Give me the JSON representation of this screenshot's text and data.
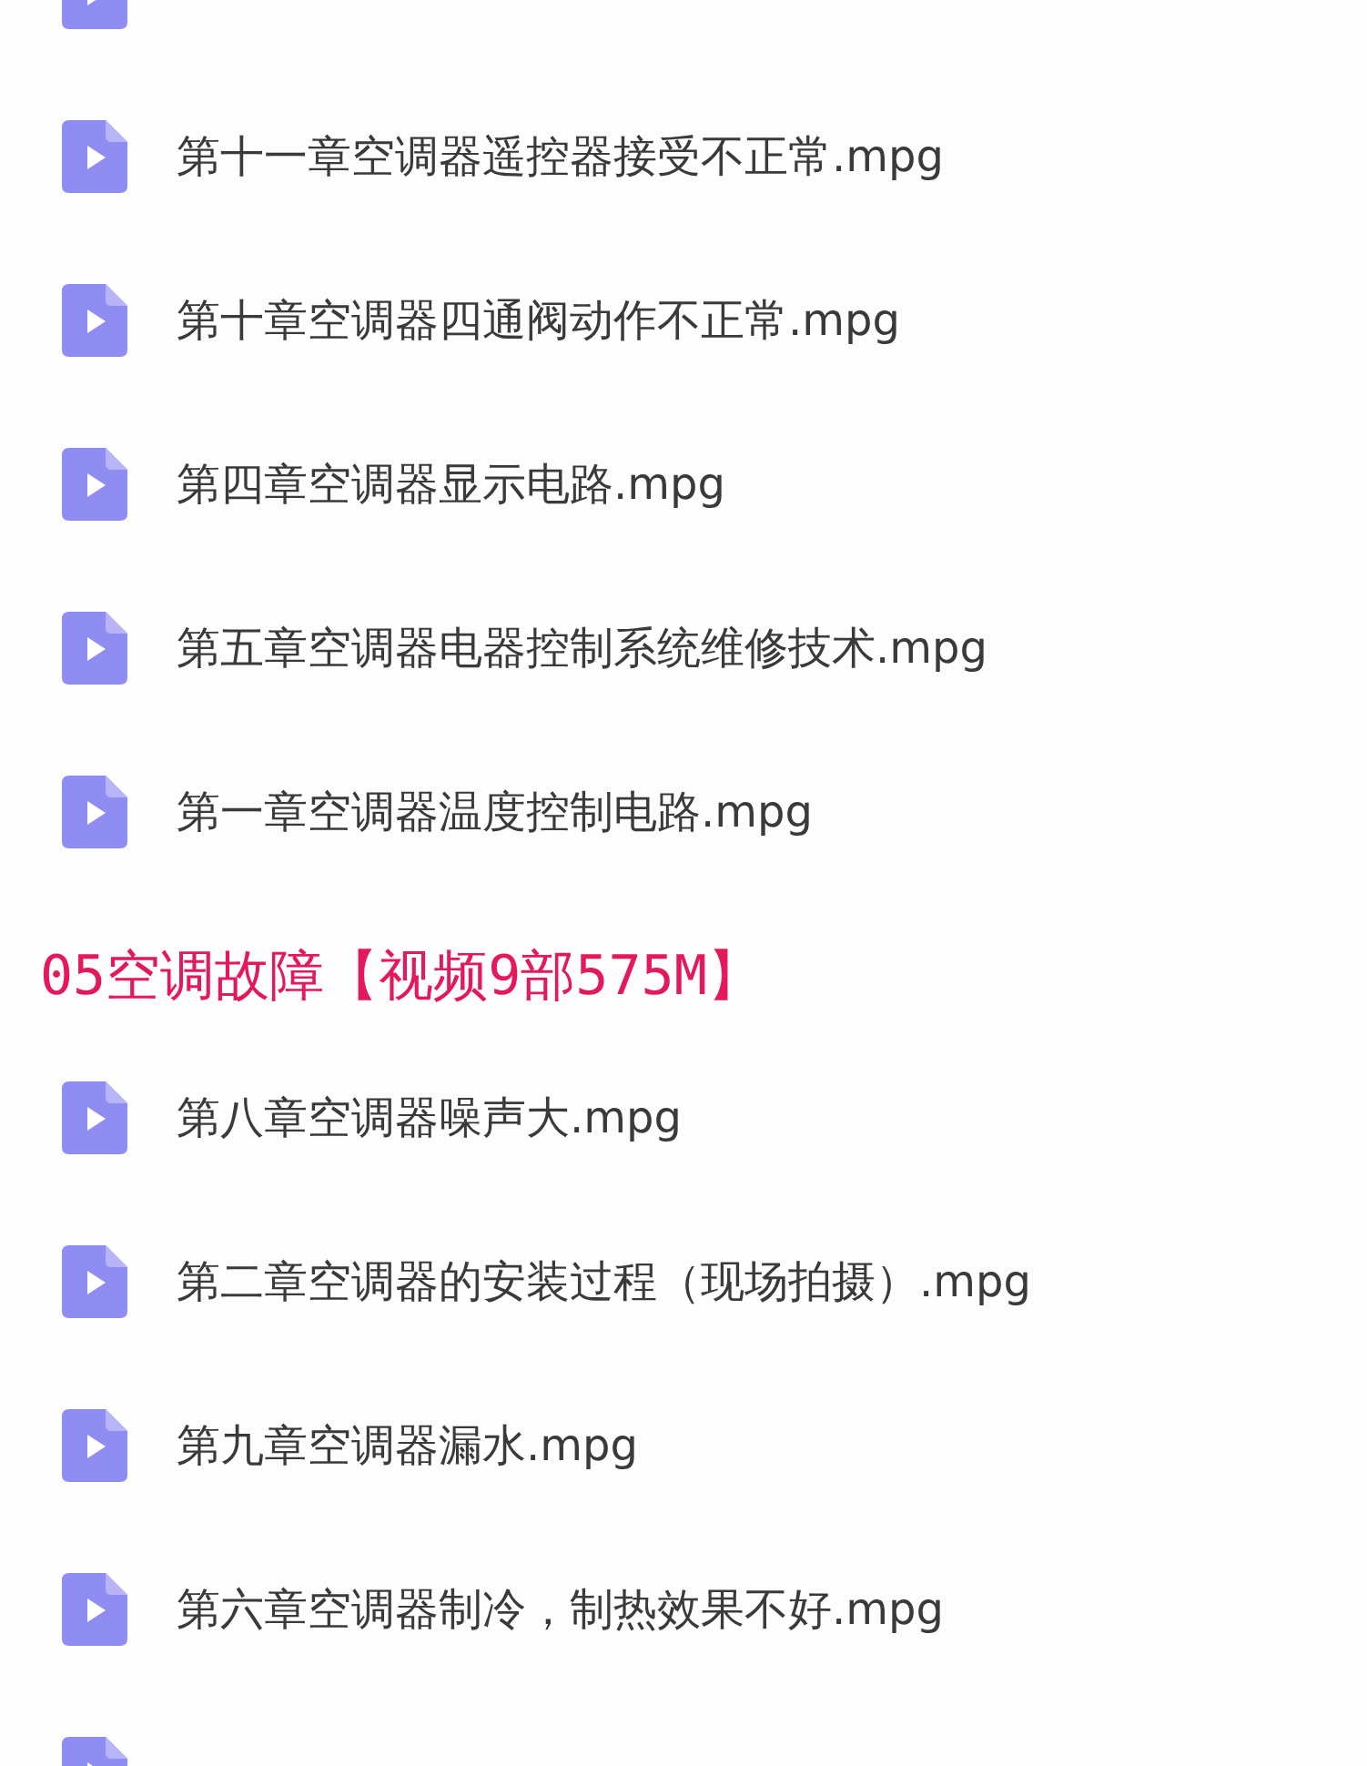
{
  "groups": [
    {
      "files": [
        {
          "kind": "cut"
        },
        {
          "kind": "file",
          "name": "第十一章空调器遥控器接受不正常.mpg"
        },
        {
          "kind": "file",
          "name": "第十章空调器四通阀动作不正常.mpg"
        },
        {
          "kind": "file",
          "name": "第四章空调器显示电路.mpg"
        },
        {
          "kind": "file",
          "name": "第五章空调器电器控制系统维修技术.mpg"
        },
        {
          "kind": "file",
          "name": "第一章空调器温度控制电路.mpg"
        }
      ]
    },
    {
      "heading": "05空调故障【视频9部575M】",
      "files": [
        {
          "kind": "file",
          "name": "第八章空调器噪声大.mpg"
        },
        {
          "kind": "file",
          "name": "第二章空调器的安装过程（现场拍摄）.mpg"
        },
        {
          "kind": "file",
          "name": "第九章空调器漏水.mpg"
        },
        {
          "kind": "file",
          "name": "第六章空调器制冷，制热效果不好.mpg"
        },
        {
          "kind": "cut"
        }
      ]
    }
  ]
}
